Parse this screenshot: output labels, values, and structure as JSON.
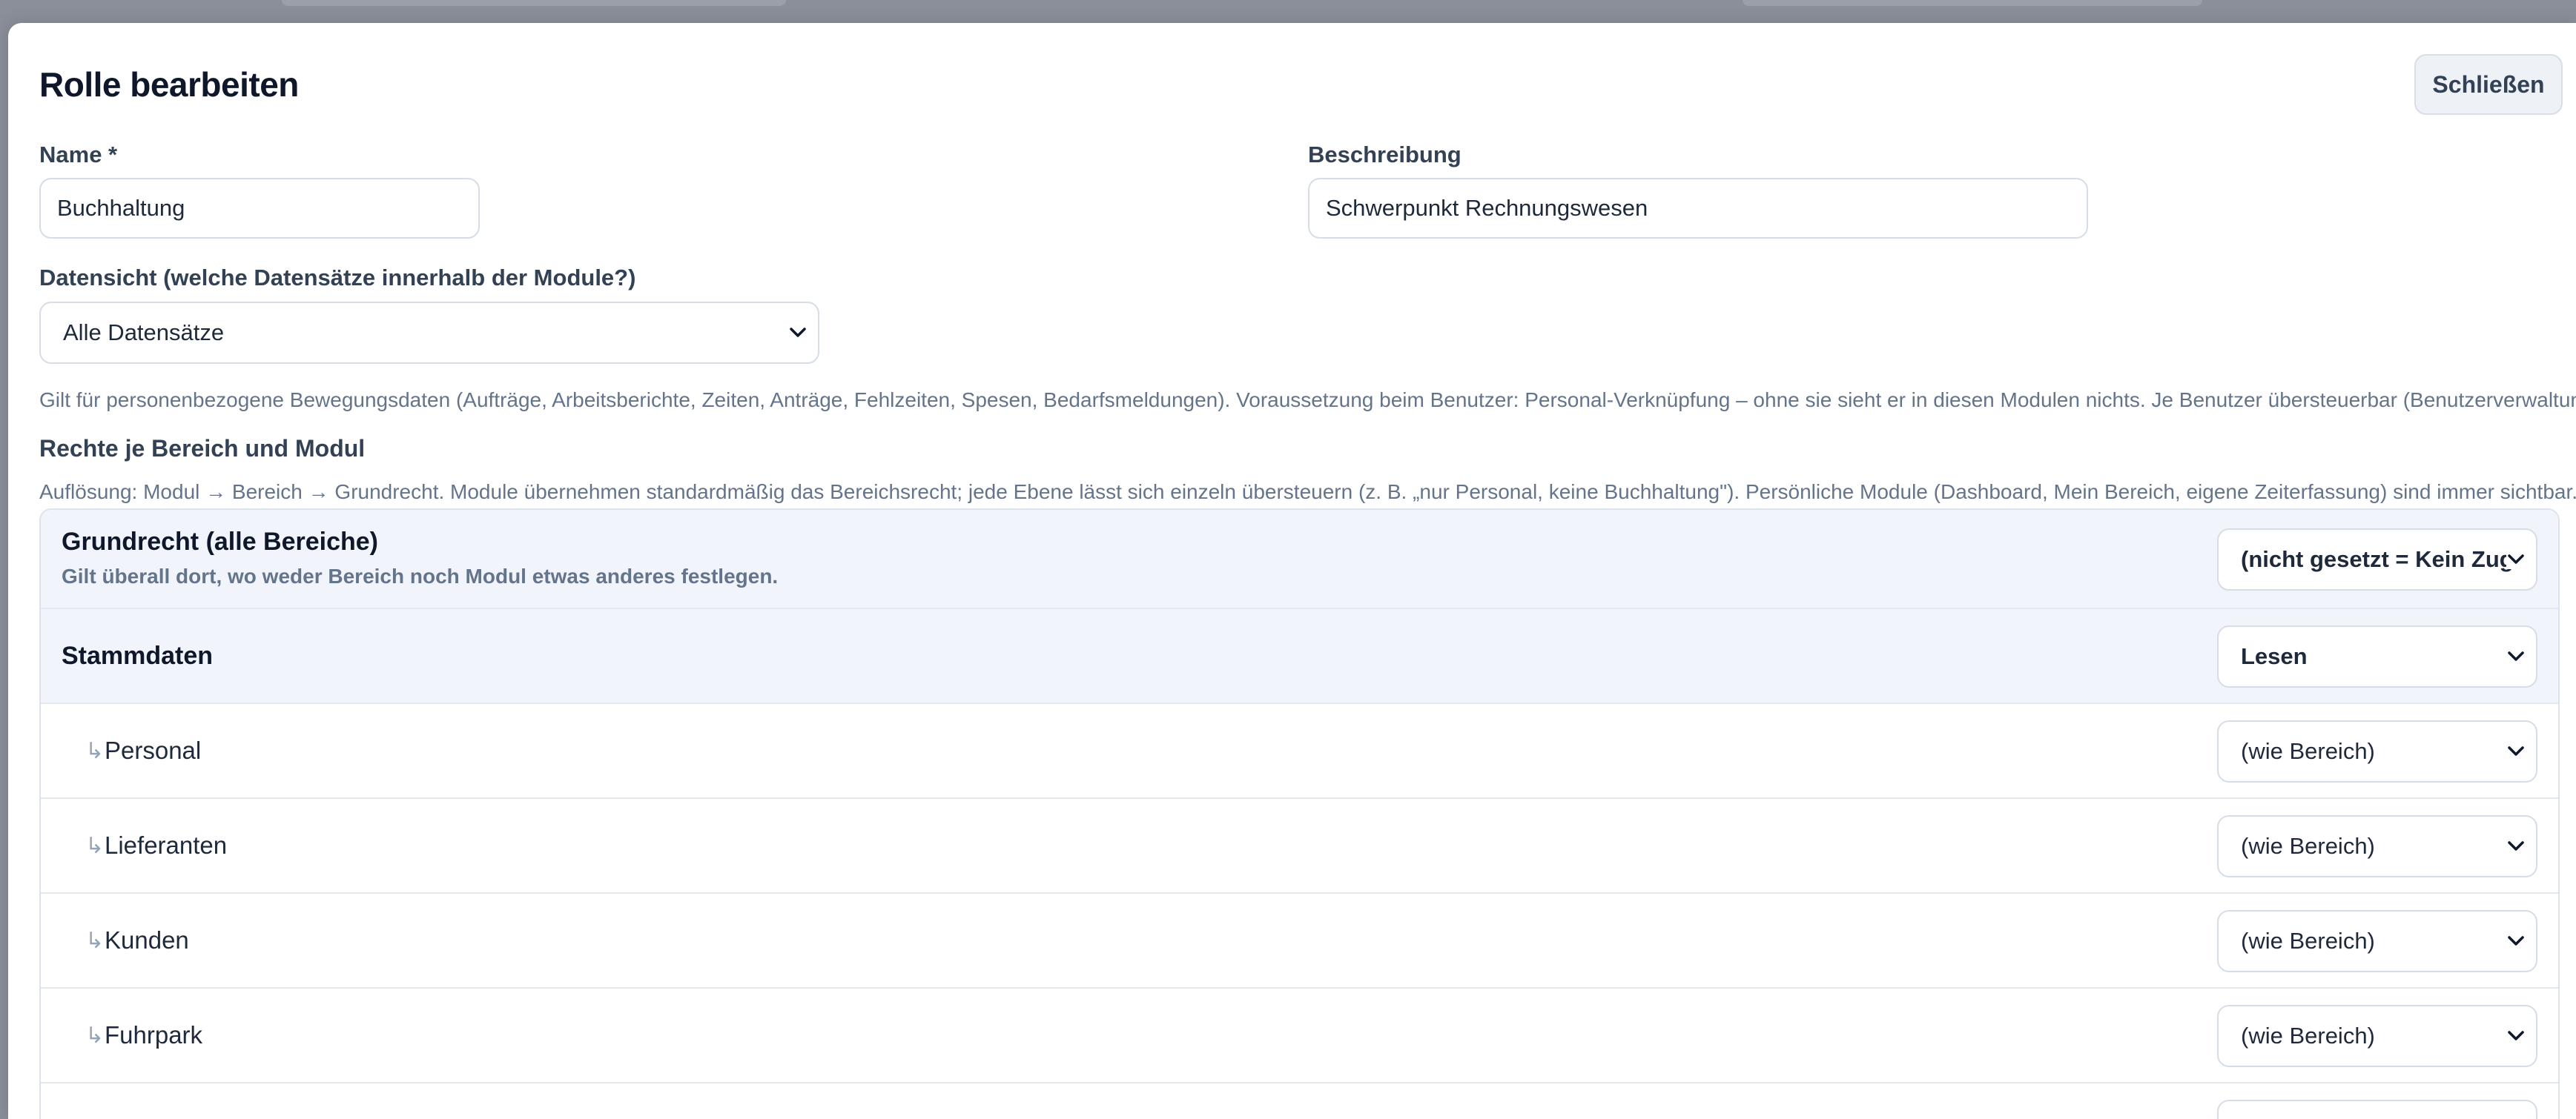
{
  "dialog": {
    "title": "Rolle bearbeiten",
    "close_label": "Schließen"
  },
  "form": {
    "name_label": "Name *",
    "name_value": "Buchhaltung",
    "description_label": "Beschreibung",
    "description_value": "Schwerpunkt Rechnungswesen",
    "data_view_label": "Datensicht (welche Datensätze innerhalb der Module?)",
    "data_view_value": "Alle Datensätze",
    "data_view_hint": "Gilt für personenbezogene Bewegungsdaten (Aufträge, Arbeitsberichte, Zeiten, Anträge, Fehlzeiten, Spesen, Bedarfsmeldungen). Voraussetzung beim Benutzer: Personal-Verknüpfung – ohne sie sieht er in diesen Modulen nichts. Je Benutzer übersteuerbar (Benutzerverwaltung)."
  },
  "permissions": {
    "section_title": "Rechte je Bereich und Modul",
    "section_hint": "Auflösung: Modul → Bereich → Grundrecht. Module übernehmen standardmäßig das Bereichsrecht; jede Ebene lässt sich einzeln übersteuern (z. B. „nur Personal, keine Buchhaltung\"). Persönliche Module (Dashboard, Mein Bereich, eigene Zeiterfassung) sind immer sichtbar.",
    "base": {
      "title": "Grundrecht (alle Bereiche)",
      "subtitle": "Gilt überall dort, wo weder Bereich noch Modul etwas anderes festlegen.",
      "value": "(nicht gesetzt = Kein Zugriff)"
    },
    "area": {
      "title": "Stammdaten",
      "value": "Lesen"
    },
    "modules": [
      {
        "label": "Personal",
        "value": "(wie Bereich)"
      },
      {
        "label": "Lieferanten",
        "value": "(wie Bereich)"
      },
      {
        "label": "Kunden",
        "value": "(wie Bereich)"
      },
      {
        "label": "Fuhrpark",
        "value": "(wie Bereich)"
      }
    ],
    "module_prefix": "↳"
  },
  "colors": {
    "accent_bg": "#f1f5fb",
    "border": "#dde3ea",
    "muted_text": "#64748b"
  }
}
